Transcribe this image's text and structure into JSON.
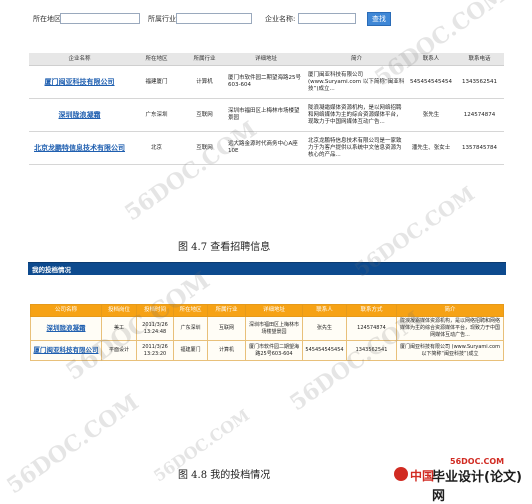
{
  "search": {
    "region_label": "所在地区:",
    "industry_label": "所属行业:",
    "company_label": "企业名称:",
    "region_value": "",
    "industry_value": "",
    "company_value": "",
    "button_label": "查找"
  },
  "table1": {
    "headers": [
      "企业名称",
      "所在地区",
      "所属行业",
      "详细地址",
      "简介",
      "联系人",
      "联系电话"
    ],
    "rows": [
      [
        "厦门闽亚科技有限公司",
        "福建厦门",
        "计算机",
        "厦门市软件园二期望海路25号603-604",
        "厦门闽亚科技有限公司 (www.Suryami.com 以下简称“闽亚科技”)成立...",
        "545454545454",
        "1343562541"
      ],
      [
        "深圳陇浪凝霜",
        "广东深圳",
        "互联网",
        "深圳市福田区上梅林市场楼望景园",
        "陇浪凝霜媒体资源机构，是以网络招聘和网络媒体为主的综合资源媒体平台，现致力于中国网媒体互动广告...",
        "张先生",
        "124574874"
      ],
      [
        "北京龙鹏特信息技术有限公司",
        "北京",
        "互联网",
        "远大路金源时代商务中心A座10E",
        "北京龙鹏特信息技术有限公司是一家致力于为客户提供以系统中文信息资源为核心的产品...",
        "潘先生、张女士",
        "1357845784"
      ]
    ]
  },
  "caption1": "图 4.7 查看招聘信息",
  "banner_label": "我的投档情况",
  "table2": {
    "headers": [
      "公司名称",
      "投档岗位",
      "投档时间",
      "所在地区",
      "所属行业",
      "详细地址",
      "联系人",
      "联系方式",
      "简介"
    ],
    "rows": [
      [
        "深圳陇浪凝霜",
        "美工",
        "2011/3/26 13:24:48",
        "广东深圳",
        "互联网",
        "深圳市福田区上梅林市场楼望景园",
        "张先生",
        "124574874",
        "陇浪凝霜媒体资源机构，是以网络招聘和网络媒体为主的综合资源媒体平台，现致力于中国网媒体互动广告..."
      ],
      [
        "厦门闽亚科技有限公司",
        "平面设计",
        "2011/3/26 13:23:20",
        "福建厦门",
        "计算机",
        "厦门市软件园二期望海路25号603-604",
        "545454545454",
        "1343562541",
        "厦门闽亚科技有限公司 (www.Suryami.com 以下简称“闽亚科技”)成立"
      ]
    ]
  },
  "caption2": "图 4.8 我的投档情况",
  "watermarks": [
    "56DOC.COM",
    "56DOC.COM",
    "56DOC.COM",
    "56DOC.COM",
    "56DOC.COM",
    "56DOC.COM",
    "56DOC.COM"
  ],
  "logo": {
    "brand_a": "中国",
    "brand_b": "毕业设计(论文)网",
    "site": "56DOC.COM"
  }
}
